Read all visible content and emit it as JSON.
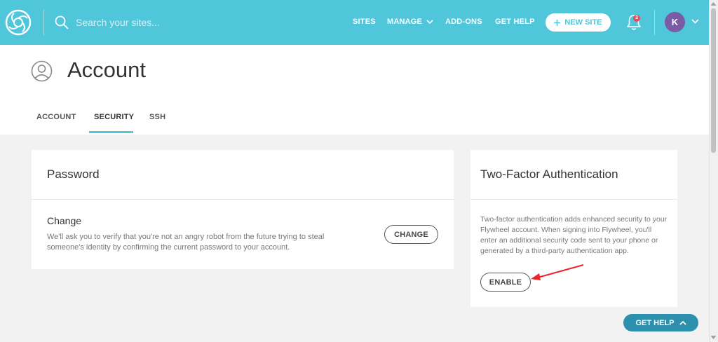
{
  "search": {
    "placeholder": "Search your sites..."
  },
  "nav": {
    "sites": "SITES",
    "manage": "MANAGE",
    "addons": "ADD-ONS",
    "get_help": "GET HELP",
    "new_site": "NEW SITE",
    "notification_count": "3",
    "avatar_initial": "K"
  },
  "page": {
    "title": "Account"
  },
  "tabs": [
    {
      "label": "ACCOUNT",
      "active": false
    },
    {
      "label": "SECURITY",
      "active": true
    },
    {
      "label": "SSH",
      "active": false
    }
  ],
  "password_card": {
    "title": "Password",
    "change_title": "Change",
    "change_desc": "We'll ask you to verify that you're not an angry robot from the future trying to steal someone's identity by confirming the current password to your account.",
    "change_button": "CHANGE"
  },
  "tfa_card": {
    "title": "Two-Factor Authentication",
    "desc": "Two-factor authentication adds enhanced security to your Flywheel account. When signing into Flywheel, you'll enter an additional security code sent to your phone or generated by a third-party authentication app.",
    "enable_button": "ENABLE"
  },
  "floating": {
    "get_help": "GET HELP"
  },
  "colors": {
    "brand": "#50c6db",
    "avatar": "#7b5aa6",
    "badge": "#e84a5f",
    "help_button": "#2c8fae",
    "annotation_arrow": "#e8232a"
  },
  "icons": [
    "flywheel-logo-icon",
    "search-icon",
    "chevron-down-icon",
    "plus-icon",
    "bell-icon",
    "user-circle-icon",
    "chevron-up-icon",
    "arrow-annotation-icon"
  ]
}
